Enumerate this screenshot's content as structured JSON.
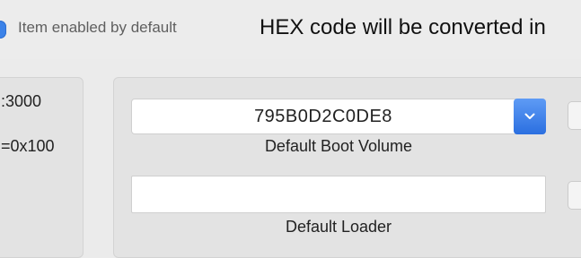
{
  "header": {
    "enabled_label": "Item enabled by default",
    "hex_notice": "HEX code will be converted in"
  },
  "left_panel": {
    "values": [
      ":3000",
      "=0x100"
    ]
  },
  "boot_volume": {
    "selected_value": "795B0D2C0DE8",
    "label": "Default Boot Volume"
  },
  "loader": {
    "value": "",
    "label": "Default Loader"
  },
  "colors": {
    "accent": "#3b82e8"
  }
}
